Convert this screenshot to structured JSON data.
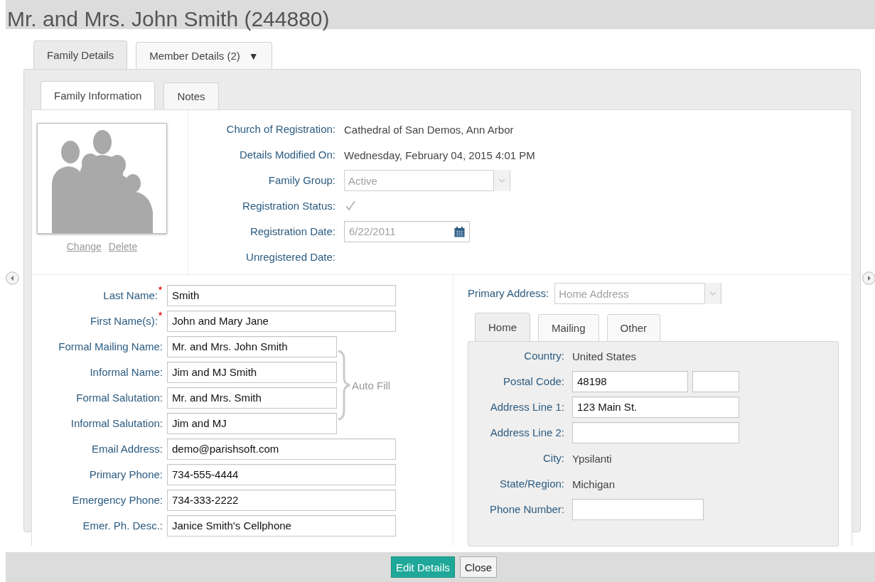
{
  "title": "Mr. and Mrs. John Smith (244880)",
  "main_tabs": [
    {
      "label": "Family Details",
      "selected": true
    },
    {
      "label": "Member Details (2)",
      "selected": false,
      "menu_arrow": "▼"
    }
  ],
  "sub_tabs": [
    {
      "label": "Family Information",
      "selected": true
    },
    {
      "label": "Notes",
      "selected": false
    }
  ],
  "photo": {
    "links": [
      "Change",
      "Delete"
    ]
  },
  "info_rows": [
    {
      "kind": "text",
      "label": "Church of Registration:",
      "value": "Cathedral of San Demos, Ann Arbor"
    },
    {
      "kind": "text",
      "label": "Details Modified On:",
      "value": "Wednesday, February 04, 2015 4:01 PM"
    },
    {
      "kind": "select",
      "label": "Family Group:",
      "value": "Active",
      "disabled": true
    },
    {
      "kind": "checkbox",
      "label": "Registration Status:",
      "checked": true,
      "disabled": true
    },
    {
      "kind": "date",
      "label": "Registration Date:",
      "value": "6/22/2011",
      "disabled": true
    },
    {
      "kind": "text",
      "label": "Unregistered Date:"
    }
  ],
  "left_form": {
    "top_fields": [
      {
        "label": "Last Name:",
        "value": "Smith",
        "required": true
      },
      {
        "label": "First Name(s):",
        "value": "John and Mary Jane",
        "required": true
      }
    ],
    "auto_fill": {
      "label": "Auto Fill",
      "fields": [
        {
          "label": "Formal Mailing Name:",
          "value": "Mr. and Mrs. John Smith",
          "required": false
        },
        {
          "label": "Informal Name:",
          "value": "Jim and MJ Smith",
          "required": false
        },
        {
          "label": "Formal Salutation:",
          "value": "Mr. and Mrs. Smith",
          "required": false
        },
        {
          "label": "Informal Salutation:",
          "value": "Jim and MJ",
          "required": false
        }
      ]
    },
    "bottom_fields": [
      {
        "label": "Email Address:",
        "value": "demo@parishsoft.com",
        "required": false
      },
      {
        "label": "Primary Phone:",
        "value": "734-555-4444",
        "required": false
      },
      {
        "label": "Emergency Phone:",
        "value": "734-333-2222",
        "required": false
      },
      {
        "label": "Emer. Ph. Desc.:",
        "value": "Janice Smith's Cellphone",
        "required": false
      }
    ]
  },
  "primary_address": {
    "label": "Primary Address:",
    "value": "Home Address",
    "disabled": true
  },
  "address_tabs": [
    {
      "label": "Home",
      "selected": true
    },
    {
      "label": "Mailing",
      "selected": false
    },
    {
      "label": "Other",
      "selected": false
    }
  ],
  "address_rows": [
    {
      "kind": "text",
      "label": "Country:",
      "value": "United States"
    },
    {
      "kind": "postal",
      "label": "Postal Code:",
      "value": "48198"
    },
    {
      "kind": "input",
      "label": "Address Line 1:",
      "value": "123 Main St."
    },
    {
      "kind": "input",
      "label": "Address Line 2:"
    },
    {
      "kind": "text",
      "label": "City:",
      "value": "Ypsilanti"
    },
    {
      "kind": "text",
      "label": "State/Region:",
      "value": "Michigan"
    },
    {
      "kind": "short_input",
      "label": "Phone Number:"
    }
  ],
  "buttons": [
    {
      "label": "Edit Details",
      "kind": "primary"
    },
    {
      "label": "Close",
      "kind": "default"
    }
  ]
}
